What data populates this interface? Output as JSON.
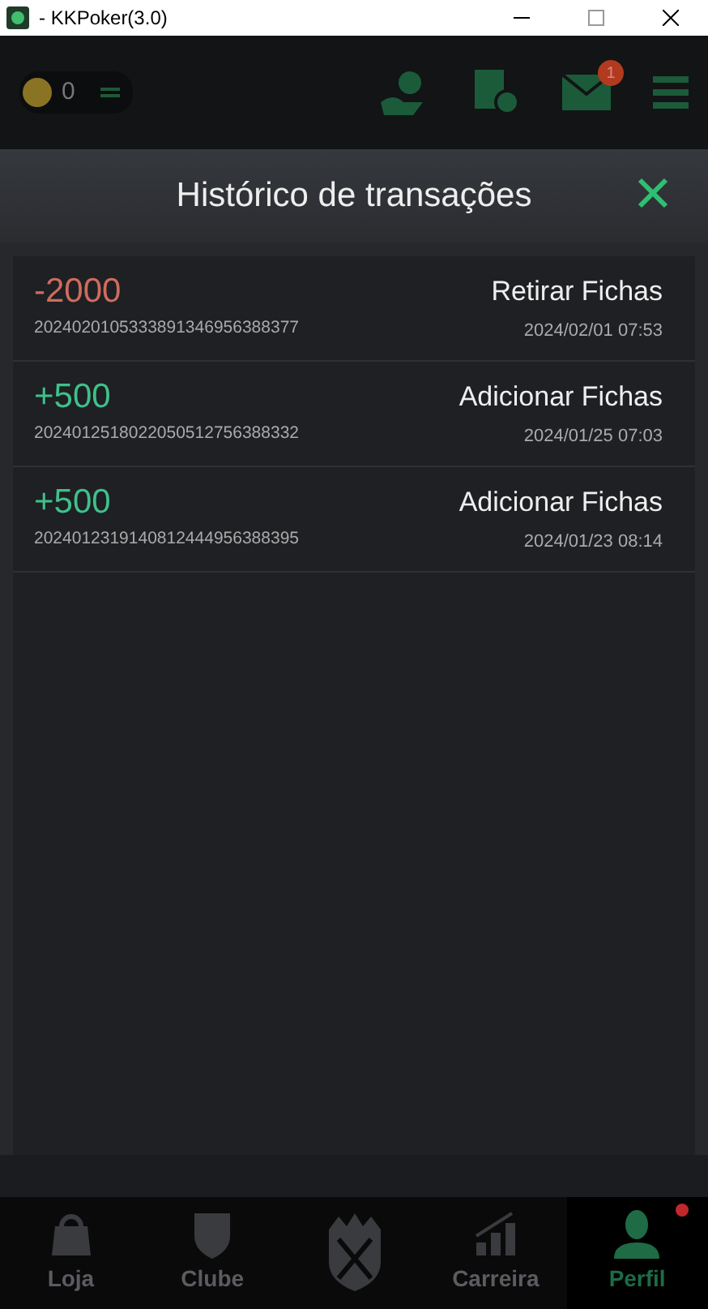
{
  "window": {
    "title": "- KKPoker(3.0)"
  },
  "top_bar": {
    "balance": "0",
    "mail_badge": "1"
  },
  "dialog": {
    "title": "Histórico de transações"
  },
  "transactions": [
    {
      "amount": "-2000",
      "kind": "debit",
      "id": "2024020105333891346956388377",
      "type": "Retirar Fichas",
      "date": "2024/02/01 07:53"
    },
    {
      "amount": "+500",
      "kind": "credit",
      "id": "2024012518022050512756388332",
      "type": "Adicionar Fichas",
      "date": "2024/01/25 07:03"
    },
    {
      "amount": "+500",
      "kind": "credit",
      "id": "2024012319140812444956388395",
      "type": "Adicionar Fichas",
      "date": "2024/01/23 08:14"
    }
  ],
  "bottom_nav": [
    {
      "kind": "tab",
      "label": "Loja",
      "selected": false
    },
    {
      "kind": "tab",
      "label": "Clube",
      "selected": false
    },
    {
      "kind": "logo",
      "selected": false
    },
    {
      "kind": "tab",
      "label": "Carreira",
      "selected": false
    },
    {
      "kind": "tab",
      "label": "Perfil",
      "selected": true,
      "dot": true
    }
  ]
}
